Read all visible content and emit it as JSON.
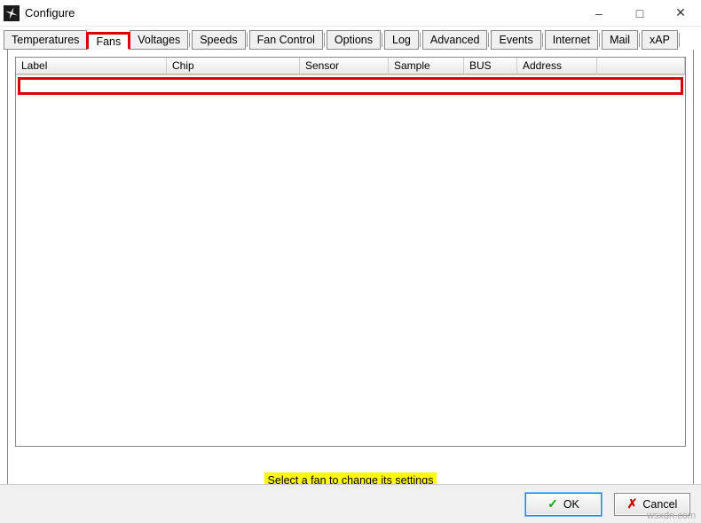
{
  "window": {
    "title": "Configure"
  },
  "tabs": {
    "items": [
      "Temperatures",
      "Fans",
      "Voltages",
      "Speeds",
      "Fan Control",
      "Options",
      "Log",
      "Advanced",
      "Events",
      "Internet",
      "Mail",
      "xAP"
    ],
    "active_index": 1
  },
  "columns": {
    "c0": "Label",
    "c1": "Chip",
    "c2": "Sensor",
    "c3": "Sample",
    "c4": "BUS",
    "c5": "Address"
  },
  "hint": "Select a fan to change its settings",
  "buttons": {
    "ok": "OK",
    "cancel": "Cancel"
  },
  "watermark": "wsxdn.com"
}
